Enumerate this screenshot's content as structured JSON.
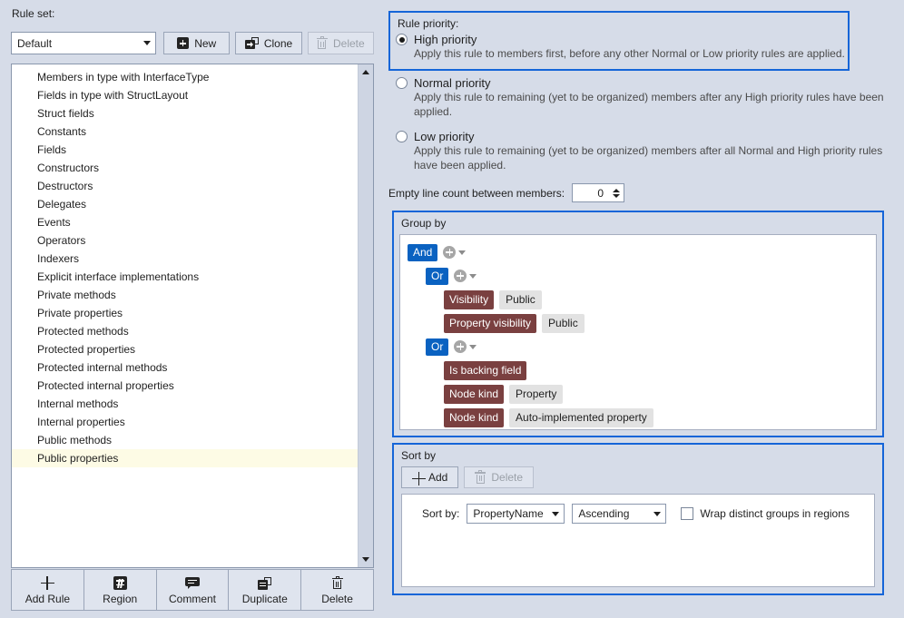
{
  "left": {
    "ruleset_label": "Rule set:",
    "ruleset_value": "Default",
    "buttons": {
      "new": "New",
      "clone": "Clone",
      "delete": "Delete"
    },
    "rules": [
      "Members in type with InterfaceType",
      "Fields in type with StructLayout",
      "Struct fields",
      "Constants",
      "Fields",
      "Constructors",
      "Destructors",
      "Delegates",
      "Events",
      "Operators",
      "Indexers",
      "Explicit interface implementations",
      "Private methods",
      "Private properties",
      "Protected methods",
      "Protected properties",
      "Protected internal methods",
      "Protected internal properties",
      "Internal methods",
      "Internal properties",
      "Public methods",
      "Public properties"
    ],
    "selected_rule": "Public properties",
    "toolbar": [
      {
        "label": "Add Rule",
        "icon": "plus-icon"
      },
      {
        "label": "Region",
        "icon": "hash-icon"
      },
      {
        "label": "Comment",
        "icon": "comment-icon"
      },
      {
        "label": "Duplicate",
        "icon": "duplicate-icon"
      },
      {
        "label": "Delete",
        "icon": "trash-icon"
      }
    ]
  },
  "right": {
    "rule_priority": {
      "title": "Rule priority:",
      "options": [
        {
          "label": "High priority",
          "selected": true,
          "description": "Apply this rule to members first, before any other Normal or Low priority rules are applied."
        },
        {
          "label": "Normal priority",
          "selected": false,
          "description": "Apply this rule to remaining (yet to be organized) members after any High priority rules have been applied."
        },
        {
          "label": "Low priority",
          "selected": false,
          "description": "Apply this rule to remaining (yet to be organized) members after all Normal and High priority rules have been applied."
        }
      ]
    },
    "empty_line": {
      "label": "Empty line count between members:",
      "value": "0"
    },
    "group_by": {
      "title": "Group by",
      "rows": [
        {
          "kind": "bool",
          "indent": 0,
          "bool": "And"
        },
        {
          "kind": "bool",
          "indent": 1,
          "bool": "Or"
        },
        {
          "kind": "cond",
          "indent": 2,
          "attr": "Visibility",
          "value": "Public"
        },
        {
          "kind": "cond",
          "indent": 2,
          "attr": "Property visibility",
          "value": "Public"
        },
        {
          "kind": "bool",
          "indent": 1,
          "bool": "Or"
        },
        {
          "kind": "cond",
          "indent": 2,
          "attr": "Is backing field",
          "value": ""
        },
        {
          "kind": "cond",
          "indent": 2,
          "attr": "Node kind",
          "value": "Property"
        },
        {
          "kind": "cond",
          "indent": 2,
          "attr": "Node kind",
          "value": "Auto-implemented property"
        }
      ]
    },
    "sort_by": {
      "title": "Sort by",
      "add_label": "Add",
      "delete_label": "Delete",
      "row_label": "Sort by:",
      "field_value": "PropertyName",
      "direction_value": "Ascending",
      "wrap_label": "Wrap distinct groups in regions",
      "wrap_checked": false
    }
  },
  "colors": {
    "background": "#d6dce8",
    "accent_blue": "#1565d8",
    "chip_bool": "#0a62c1",
    "chip_attr": "#7a4040",
    "chip_value": "#e2e2e2",
    "selection": "#fdfbe5"
  }
}
